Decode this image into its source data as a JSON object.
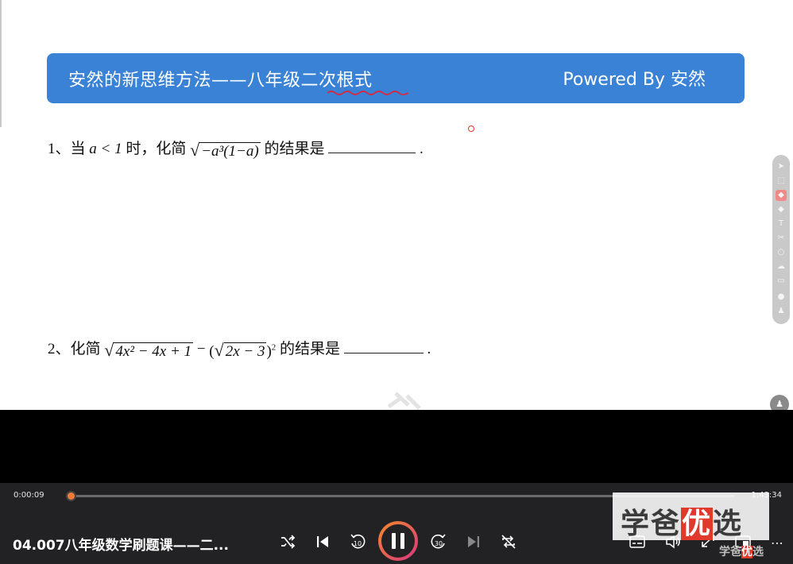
{
  "slide": {
    "banner_title": "安然的新思维方法——八年级二次根式",
    "banner_powered": "Powered By  安然",
    "problem1": {
      "prefix": "1、当",
      "cond": "a < 1",
      "mid": "时，化简",
      "radicand": "−a³(1−a)",
      "suffix": "的结果是",
      "end": "."
    },
    "problem2": {
      "prefix": "2、化简",
      "radicand": "4x² − 4x + 1",
      "minus": "−",
      "inner_radicand": "2x − 3",
      "suffix": "的结果是",
      "end": "."
    }
  },
  "toolbar": {
    "tools": [
      "pointer-icon",
      "select-icon",
      "highlighter-icon",
      "eraser-icon",
      "text-icon",
      "scissors-icon",
      "shape-icon",
      "cloud-icon",
      "board-icon",
      "chat-icon",
      "user-icon"
    ],
    "fold_icon": "user-fold-icon"
  },
  "player": {
    "time_current": "0:00:09",
    "time_total": "1:43:34",
    "progress": 0.0015,
    "title": "04.007八年级数学刷题课——二...",
    "colors": {
      "accent": "#f07b38",
      "banner": "#3a82d6"
    },
    "brand": {
      "part1": "学爸",
      "part2": "优",
      "part3": "选"
    },
    "brand_small": {
      "part1": "学爸",
      "part2": "优",
      "part3": "选"
    }
  }
}
